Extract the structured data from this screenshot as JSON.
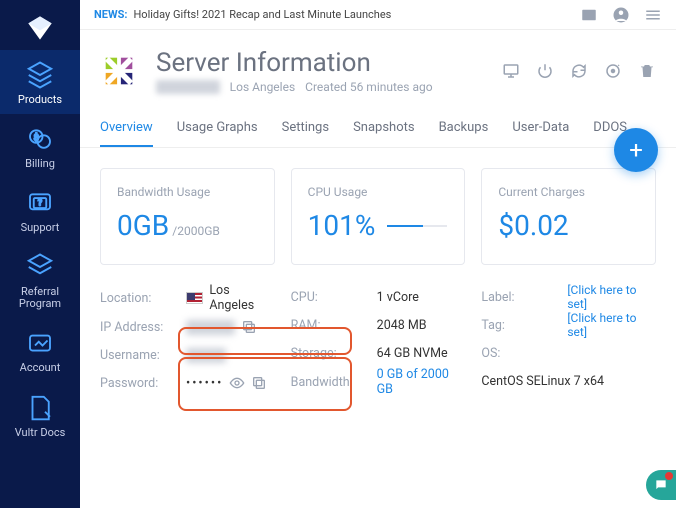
{
  "news": {
    "label": "NEWS:",
    "text": "Holiday Gifts! 2021 Recap and Last Minute Launches"
  },
  "sidebar": {
    "items": [
      {
        "label": "Products"
      },
      {
        "label": "Billing"
      },
      {
        "label": "Support"
      },
      {
        "label": "Referral Program"
      },
      {
        "label": "Account"
      },
      {
        "label": "Vultr Docs"
      }
    ]
  },
  "header": {
    "title": "Server Information",
    "location": "Los Angeles",
    "created": "Created 56 minutes ago"
  },
  "tabs": [
    "Overview",
    "Usage Graphs",
    "Settings",
    "Snapshots",
    "Backups",
    "User-Data",
    "DDOS"
  ],
  "cards": {
    "bandwidth": {
      "title": "Bandwidth Usage",
      "value": "0GB",
      "suffix": "/2000GB"
    },
    "cpu": {
      "title": "CPU Usage",
      "value": "101%"
    },
    "charges": {
      "title": "Current Charges",
      "value": "$0.02"
    }
  },
  "details": {
    "col1": {
      "location_label": "Location:",
      "location_value": "Los Angeles",
      "ip_label": "IP Address:",
      "user_label": "Username:",
      "pass_label": "Password:",
      "pass_value": "••••••"
    },
    "col2": {
      "cpu_label": "CPU:",
      "cpu_value": "1 vCore",
      "ram_label": "RAM:",
      "ram_value": "2048 MB",
      "storage_label": "Storage:",
      "storage_value": "64 GB NVMe",
      "bw_label": "Bandwidth:",
      "bw_value": "0 GB of 2000 GB"
    },
    "col3": {
      "label_label": "Label:",
      "label_action": "[Click here to set]",
      "tag_label": "Tag:",
      "tag_action": "[Click here to set]",
      "os_label": "OS:",
      "os_value": "CentOS SELinux 7 x64"
    }
  }
}
